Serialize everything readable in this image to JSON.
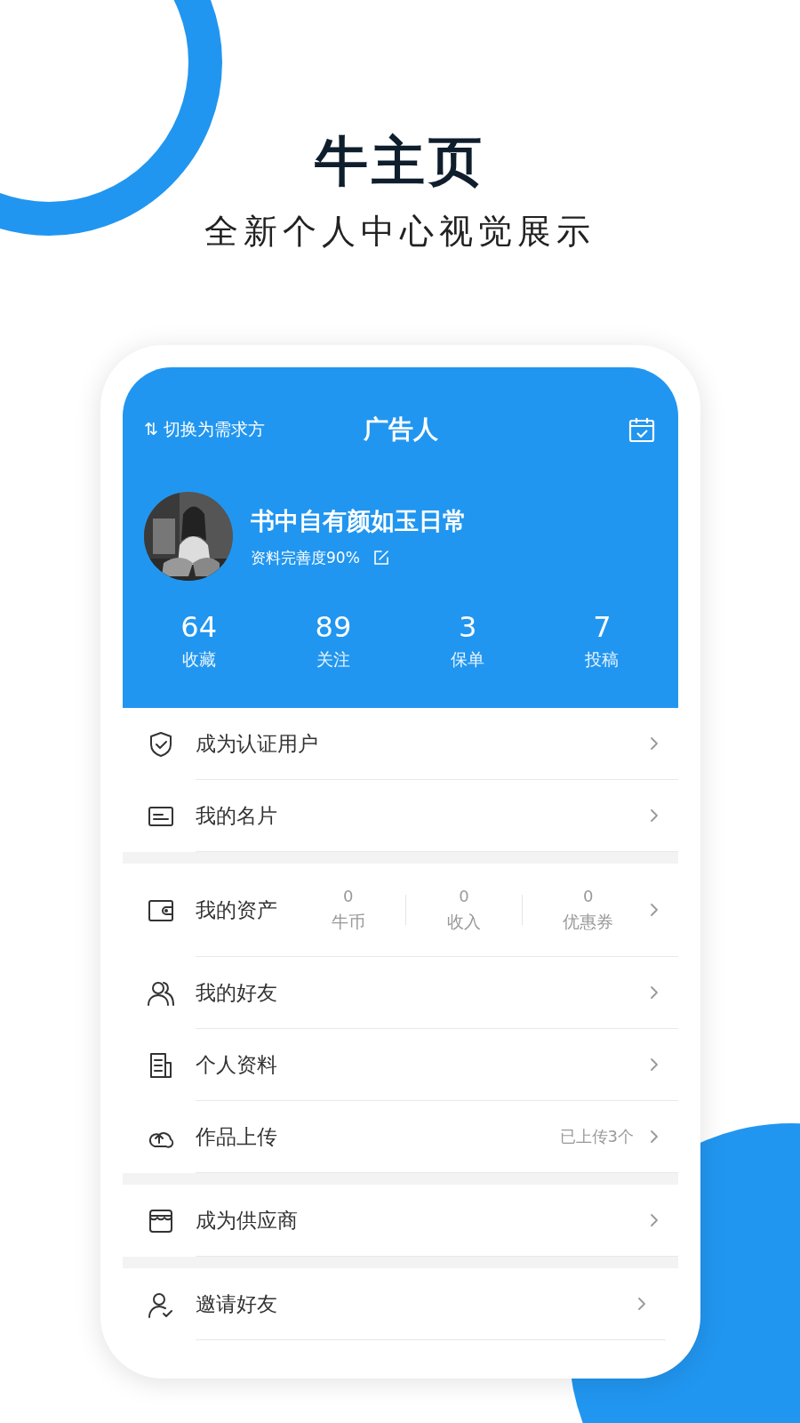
{
  "headline": {
    "title": "牛主页",
    "subtitle": "全新个人中心视觉展示"
  },
  "app": {
    "switch_label": "切换为需求方",
    "switch_icon": "⇅",
    "title": "广告人",
    "profile": {
      "name": "书中自有颜如玉日常",
      "completion": "资料完善度90%"
    },
    "stats": [
      {
        "value": "64",
        "label": "收藏"
      },
      {
        "value": "89",
        "label": "关注"
      },
      {
        "value": "3",
        "label": "保单"
      },
      {
        "value": "7",
        "label": "投稿"
      }
    ],
    "menu_groups": [
      [
        {
          "kind": "plain",
          "label": "成为认证用户"
        },
        {
          "kind": "plain",
          "label": "我的名片"
        }
      ],
      [
        {
          "kind": "assets",
          "label": "我的资产",
          "stats": [
            {
              "value": "0",
              "label": "牛币"
            },
            {
              "value": "0",
              "label": "收入"
            },
            {
              "value": "0",
              "label": "优惠券"
            }
          ]
        },
        {
          "kind": "plain",
          "label": "我的好友"
        },
        {
          "kind": "plain",
          "label": "个人资料"
        },
        {
          "kind": "note",
          "label": "作品上传",
          "note": "已上传3个"
        }
      ],
      [
        {
          "kind": "plain",
          "label": "成为供应商"
        }
      ],
      [
        {
          "kind": "plain",
          "label": "邀请好友"
        }
      ]
    ]
  }
}
